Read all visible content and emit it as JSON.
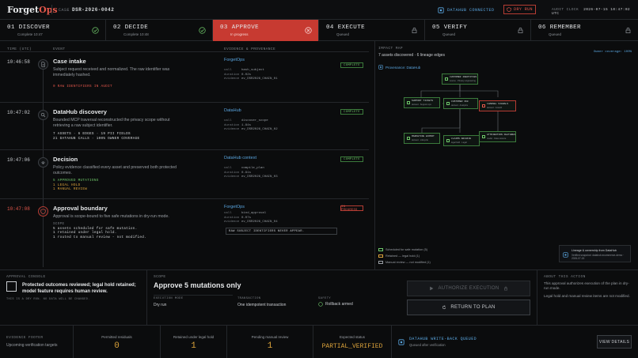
{
  "header": {
    "logo_main": "Forget",
    "logo_accent": "Ops",
    "case_label": "CASE",
    "case_id": "DSR-2026-0042",
    "datahub_status": "DATAHUB CONNECTED",
    "dry_run": "DRY RUN",
    "audit_label": "AUDIT CLOCK",
    "audit_time": "2026-07-15 10:47:02 UTC"
  },
  "steps": [
    {
      "label": "01 DISCOVER",
      "sub": "Complete 10:47",
      "state": "done"
    },
    {
      "label": "02 DECIDE",
      "sub": "Complete 10:48",
      "state": "done"
    },
    {
      "label": "03 APPROVE",
      "sub": "In progress",
      "state": "active"
    },
    {
      "label": "04 EXECUTE",
      "sub": "Queued",
      "state": "queued"
    },
    {
      "label": "05 VERIFY",
      "sub": "Queued",
      "state": "queued"
    },
    {
      "label": "06 REMEMBER",
      "sub": "Queued",
      "state": "queued"
    }
  ],
  "timeline": {
    "col_time": "TIME (UTC)",
    "col_event": "EVENT",
    "col_evidence": "EVIDENCE & PROVENANCE",
    "events": [
      {
        "time": "10:46:58",
        "title": "Case intake",
        "desc": "Subject request received and normalized. The raw identifier was immediately hashed.",
        "meta": [
          "0 RAW IDENTIFIERS IN AUDIT"
        ],
        "prov": "ForgetOps",
        "kv": [
          [
            "call",
            "hash_subject"
          ],
          [
            "duration",
            "0.02s"
          ],
          [
            "evidence",
            "ev_DSR2026_CHAIN_01"
          ]
        ],
        "badge": "COMPLETE"
      },
      {
        "time": "10:47:02",
        "title": "DataHub discovery",
        "desc": "Bounded MCP traversal reconstructed the privacy scope without retrieving a raw subject identifier.",
        "meta": [
          "7 ASSETS · 6 EDGES · 19 PII FIELDS",
          "21 DATAHUB CALLS · 100% OWNER COVERAGE"
        ],
        "prov": "DataHub",
        "kv": [
          [
            "call",
            "discover_scope"
          ],
          [
            "duration",
            "1.84s"
          ],
          [
            "evidence",
            "ev_DSR2026_CHAIN_02"
          ]
        ],
        "badge": "COMPLETE"
      },
      {
        "time": "10:47:06",
        "title": "Decision",
        "desc": "Policy evidence classified every asset and preserved both protected outcomes.",
        "meta": [
          "5 APPROVED MUTATIONS",
          "1 LEGAL HOLD",
          "1 MANUAL REVIEW"
        ],
        "prov": "DataHub context",
        "kv": [
          [
            "call",
            "compile_plan"
          ],
          [
            "duration",
            "0.91s"
          ],
          [
            "evidence",
            "ev_DSR2026_CHAIN_03"
          ]
        ],
        "badge": "COMPLETE"
      },
      {
        "time": "10:47:08",
        "title": "Approval boundary",
        "desc": "Approval is scope-bound to five safe mutations in dry-run mode.",
        "meta": [
          "SCOPE",
          "5 assets scheduled for safe mutation.",
          "1 retained under legal hold.",
          "1 routed to manual review - not modified."
        ],
        "prov": "ForgetOps",
        "kv": [
          [
            "call",
            "bind_approval"
          ],
          [
            "duration",
            "0.07s"
          ],
          [
            "evidence",
            "ev_DSR2026_CHAIN_04"
          ]
        ],
        "note": "RAW SUBJECT IDENTIFIERS NEVER APPEAR.",
        "badge": "IN PROGRESS"
      }
    ]
  },
  "impact": {
    "label": "IMPACT MAP",
    "summary": "7 assets discovered · 6 lineage edges",
    "coverage": "Owner coverage: 100%",
    "provenance": "Provenance: DataHub",
    "nodes": [
      {
        "name": "CUSTOMER IDENTITIES",
        "sub": "source · Privacy engineering",
        "kind": "green"
      },
      {
        "name": "SUPPORT TICKETS",
        "sub": "derived · Support ops",
        "kind": "green"
      },
      {
        "name": "CUSTOMER 360",
        "sub": "derived · Analytics",
        "kind": "green"
      },
      {
        "name": "CHANNEL SIGNALS",
        "sub": "derived · Growth",
        "kind": "red"
      },
      {
        "name": "MARKETING EXPORT",
        "sub": "derived · Lifecycle",
        "kind": "green"
      },
      {
        "name": "CLAIMS ARCHIVE",
        "sub": "legal hold · Legal",
        "kind": "green"
      },
      {
        "name": "ATTRIBUTION FEATURES",
        "sub": "model · Data science",
        "kind": "green"
      }
    ],
    "legend": [
      "Scheduled for safe mutation (5)",
      "Retained — legal hold (1)",
      "Manual review — not modified (1)"
    ],
    "lineage_title": "Lineage & ownership from DataHub",
    "lineage_sub": "Verified snapshot: datahub.ecommerce-demo · 2026-07-15"
  },
  "console": {
    "label": "APPROVAL CONSOLE",
    "check_text": "Protected outcomes reviewed; legal hold retained; model feature requires human review.",
    "footnote": "THIS IS A DRY RUN. NO DATA WILL BE CHANGED."
  },
  "scope": {
    "label": "SCOPE",
    "title": "Approve 5 mutations only",
    "exec_label": "EXECUTION MODE",
    "exec_value": "Dry run",
    "tx_label": "TRANSACTION",
    "tx_value": "One idempotent transaction",
    "safety_label": "SAFETY",
    "safety_value": "Rollback armed"
  },
  "actions": {
    "authorize": "AUTHORIZE EXECUTION",
    "return": "RETURN TO PLAN"
  },
  "about": {
    "label": "ABOUT THIS ACTION",
    "p1": "This approval authorizes execution of the plan in dry-run mode.",
    "p2": "Legal hold and manual review items are not modified."
  },
  "footer": {
    "label": "EVIDENCE FOOTER",
    "sub": "Upcoming verification targets",
    "residuals_label": "Permitted residuals",
    "residuals": "0",
    "retained_label": "Retained under legal hold",
    "retained": "1",
    "pending_label": "Pending manual review",
    "pending": "1",
    "expected_label": "Expected status",
    "expected": "PARTIAL_VERIFIED",
    "writeback": "DATAHUB WRITE-BACK QUEUED",
    "writeback_sub": "Queued after verification",
    "details": "VIEW DETAILS"
  },
  "colors": {
    "accent_red": "#c73a31",
    "ok_green": "#6fc86a",
    "datahub_blue": "#5aa6e0",
    "amber": "#d9a13a"
  }
}
